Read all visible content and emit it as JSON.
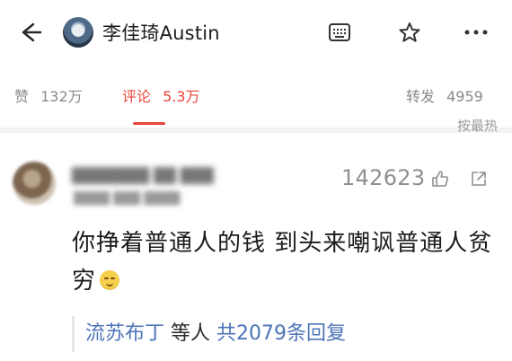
{
  "header": {
    "title": "李佳琦Austin",
    "back_icon": "arrow-left-icon",
    "actions": [
      "keyboard-icon",
      "star-icon",
      "more-icon"
    ]
  },
  "stats": {
    "like_label": "赞",
    "like_count": "132万",
    "comment_label": "评论",
    "comment_count": "5.3万",
    "repost_label": "转发",
    "repost_count": "4959",
    "active_tab": "评论",
    "active_color": "#e8443a"
  },
  "sort": {
    "label": "按最热"
  },
  "comment": {
    "likes": "142623",
    "text": "你挣着普通人的钱 到头来嘲讽普通人贫穷",
    "replies": {
      "user": "流苏布丁",
      "middle": "等人",
      "summary": "共2079条回复"
    }
  }
}
